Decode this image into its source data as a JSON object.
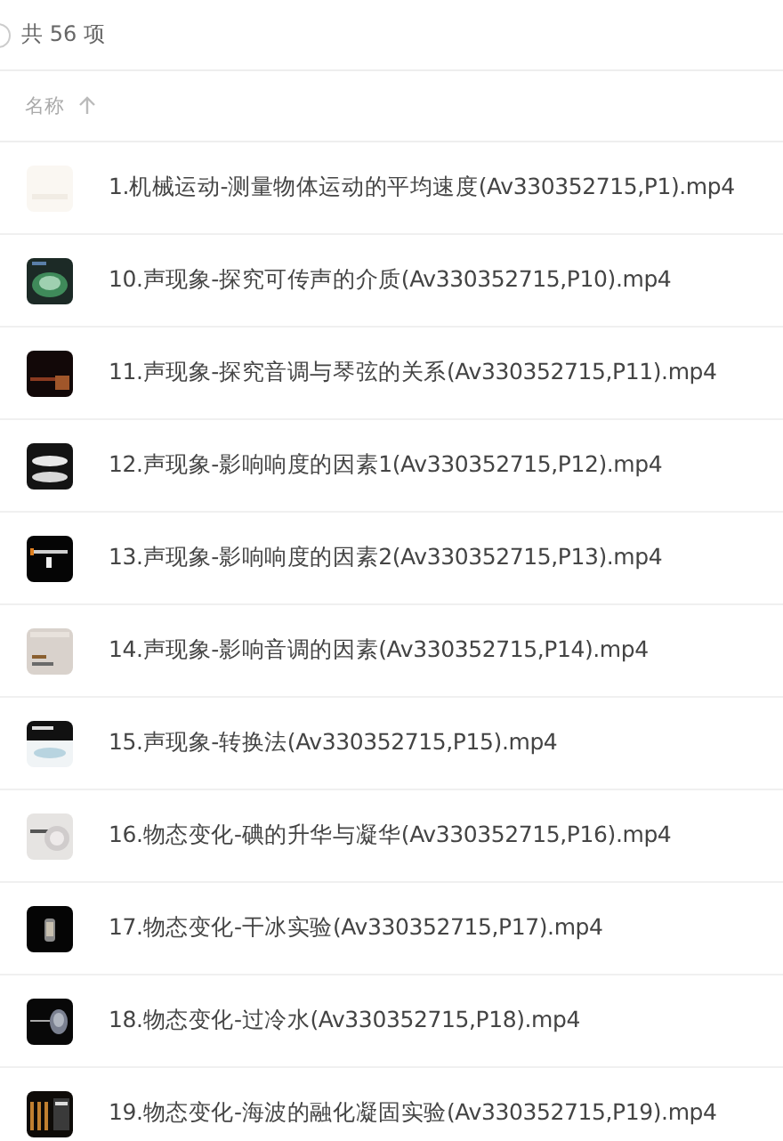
{
  "summary": {
    "select_all_checked": false,
    "count": "共 56 项"
  },
  "table": {
    "columns": [
      {
        "label": "名称",
        "sorted_ascending": true
      }
    ],
    "rows": [
      {
        "name": "1.机械运动-测量物体运动的平均速度(Av330352715,P1).mp4"
      },
      {
        "name": "10.声现象-探究可传声的介质(Av330352715,P10).mp4"
      },
      {
        "name": "11.声现象-探究音调与琴弦的关系(Av330352715,P11).mp4"
      },
      {
        "name": "12.声现象-影响响度的因素1(Av330352715,P12).mp4"
      },
      {
        "name": "13.声现象-影响响度的因素2(Av330352715,P13).mp4"
      },
      {
        "name": "14.声现象-影响音调的因素(Av330352715,P14).mp4"
      },
      {
        "name": "15.声现象-转换法(Av330352715,P15).mp4"
      },
      {
        "name": "16.物态变化-碘的升华与凝华(Av330352715,P16).mp4"
      },
      {
        "name": "17.物态变化-干冰实验(Av330352715,P17).mp4"
      },
      {
        "name": "18.物态变化-过冷水(Av330352715,P18).mp4"
      },
      {
        "name": "19.物态变化-海波的融化凝固实验(Av330352715,P19).mp4"
      }
    ]
  }
}
